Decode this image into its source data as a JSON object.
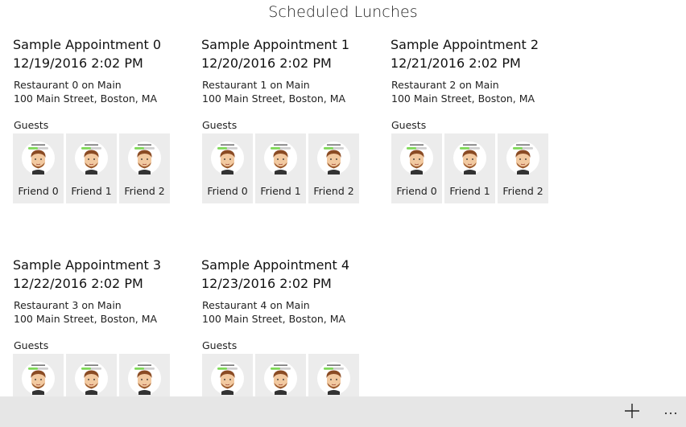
{
  "page": {
    "title": "Scheduled Lunches"
  },
  "appointments": [
    {
      "title": "Sample Appointment 0",
      "datetime": "12/19/2016 2:02 PM",
      "restaurant": "Restaurant 0 on Main",
      "address": "100 Main Street, Boston, MA",
      "guests_label": "Guests",
      "guests": [
        {
          "name": "Friend 0"
        },
        {
          "name": "Friend 1"
        },
        {
          "name": "Friend 2"
        }
      ]
    },
    {
      "title": "Sample Appointment 1",
      "datetime": "12/20/2016 2:02 PM",
      "restaurant": "Restaurant 1 on Main",
      "address": "100 Main Street, Boston, MA",
      "guests_label": "Guests",
      "guests": [
        {
          "name": "Friend 0"
        },
        {
          "name": "Friend 1"
        },
        {
          "name": "Friend 2"
        }
      ]
    },
    {
      "title": "Sample Appointment 2",
      "datetime": "12/21/2016 2:02 PM",
      "restaurant": "Restaurant 2 on Main",
      "address": "100 Main Street, Boston, MA",
      "guests_label": "Guests",
      "guests": [
        {
          "name": "Friend 0"
        },
        {
          "name": "Friend 1"
        },
        {
          "name": "Friend 2"
        }
      ]
    },
    {
      "title": "Sample Appointment 3",
      "datetime": "12/22/2016 2:02 PM",
      "restaurant": "Restaurant 3 on Main",
      "address": "100 Main Street, Boston, MA",
      "guests_label": "Guests",
      "guests": [
        {
          "name": ""
        },
        {
          "name": ""
        },
        {
          "name": ""
        }
      ]
    },
    {
      "title": "Sample Appointment 4",
      "datetime": "12/23/2016 2:02 PM",
      "restaurant": "Restaurant 4 on Main",
      "address": "100 Main Street, Boston, MA",
      "guests_label": "Guests",
      "guests": [
        {
          "name": ""
        },
        {
          "name": ""
        },
        {
          "name": ""
        }
      ]
    }
  ],
  "command_bar": {
    "add_icon": "plus-icon",
    "more_icon": "more-ellipsis-icon"
  },
  "colors": {
    "tile_background": "#ececec",
    "command_bar_background": "#e6e6e6",
    "avatar_progress": "#7ed957"
  }
}
